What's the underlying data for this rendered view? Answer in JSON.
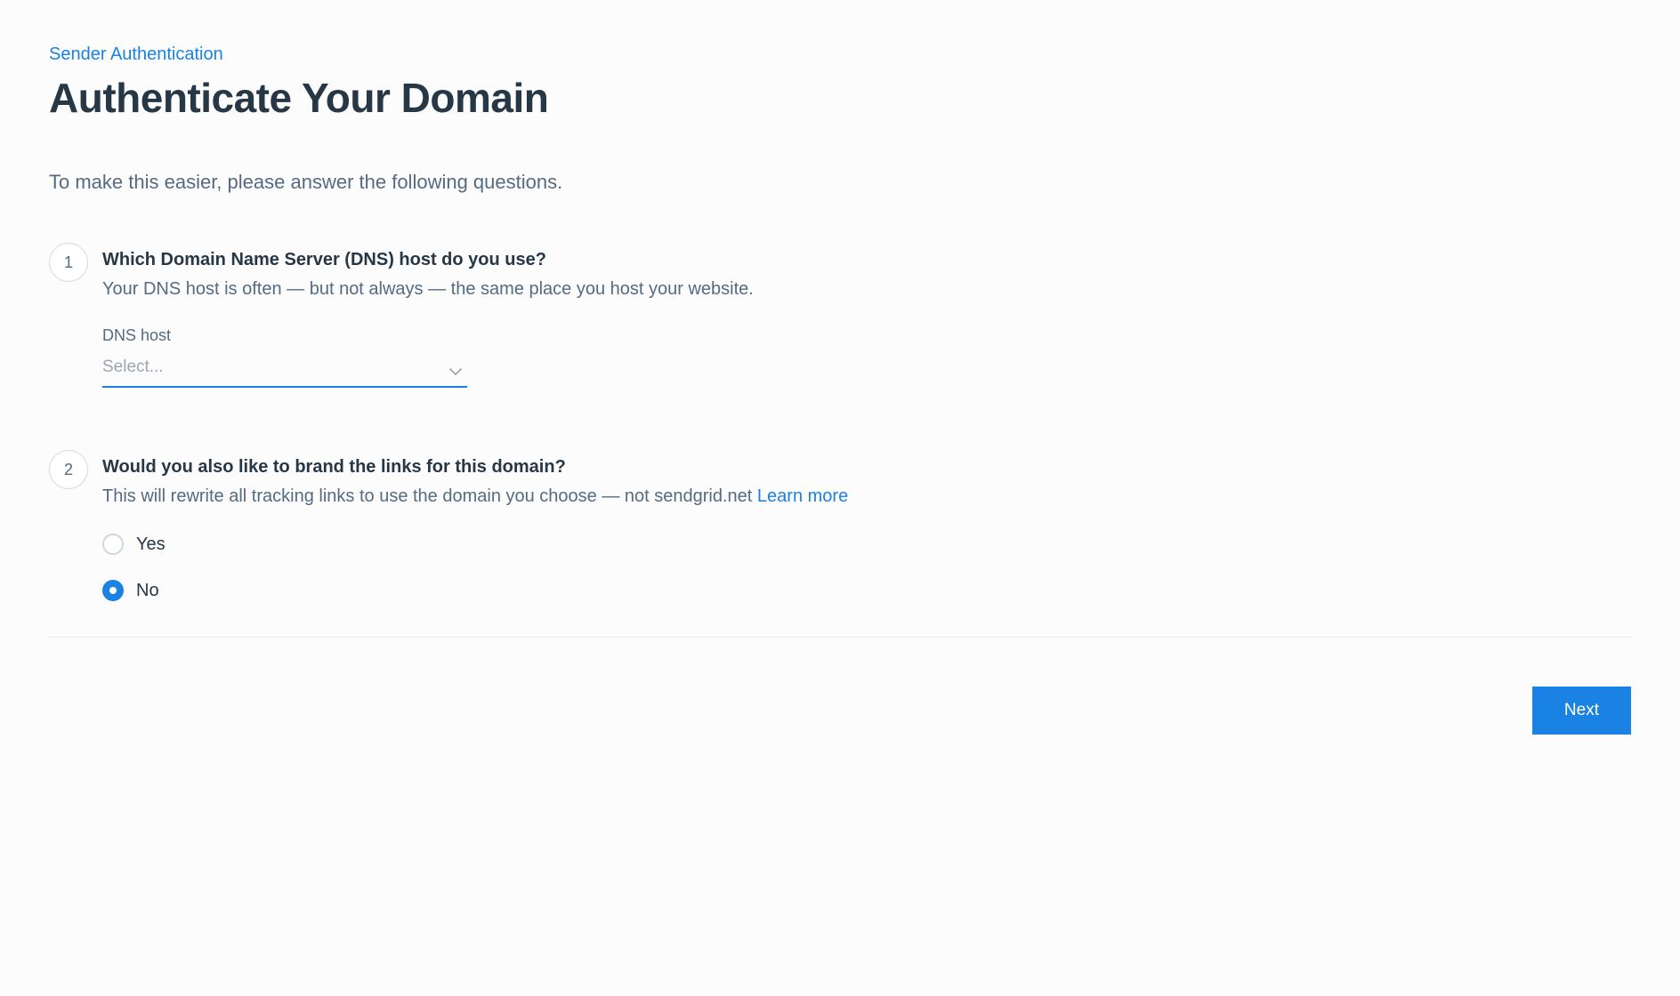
{
  "breadcrumb": "Sender Authentication",
  "title": "Authenticate Your Domain",
  "intro": "To make this easier, please answer the following questions.",
  "steps": [
    {
      "number": "1",
      "title": "Which Domain Name Server (DNS) host do you use?",
      "description": "Your DNS host is often — but not always — the same place you host your website.",
      "field_label": "DNS host",
      "select_placeholder": "Select..."
    },
    {
      "number": "2",
      "title": "Would you also like to brand the links for this domain?",
      "description_prefix": "This will rewrite all tracking links to use the domain you choose — not sendgrid.net ",
      "learn_more": "Learn more",
      "options": {
        "yes": "Yes",
        "no": "No"
      },
      "selected": "no"
    }
  ],
  "footer": {
    "next_label": "Next"
  }
}
